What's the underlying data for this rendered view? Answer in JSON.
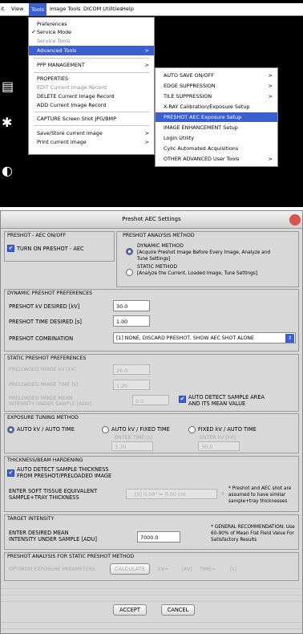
{
  "menubar": {
    "items": [
      "it",
      "View",
      "Tools",
      "Image Tools",
      "DICOM Utilities",
      "Help"
    ]
  },
  "tools_menu": {
    "items": [
      "Preferences",
      "Service Mode",
      "Service Tools",
      "Advanced Tools",
      "PPP MANAGEMENT",
      "PROPERTIES",
      "EDIT   Current Image Record",
      "DELETE  Current Image Record",
      "ADD    Current Image Record",
      "CAPTURE Screen Shot JPG/BMP",
      "Save/Store current image",
      "Print current image"
    ]
  },
  "advanced_menu": {
    "items": [
      "AUTO SAVE ON/OFF",
      "EDGE SUPPRESSION",
      "TILE SUPPRESSION",
      "X-RAY Calibration/Exposure Setup",
      "PRESHOT AEC Exposure Setup",
      "IMAGE ENHANCEMENT Setup",
      "Login Utility",
      "Cylic Automated Acquisitions",
      "OTHER ADVANCED User Tools"
    ]
  },
  "arrow": ">",
  "check": "✔",
  "dialog": {
    "title": "Preshot AEC Settings",
    "onoff": {
      "group": "PRESHOT - AEC ON/OFF",
      "label": "TURN ON PRESHOT - AEC"
    },
    "method": {
      "group": "PRESHOT ANALYSIS METHOD",
      "dynamic": "DYNAMIC METHOD",
      "dynamic_desc1": "[Acquire Preshot Image Before Every Image, Analyze and",
      "dynamic_desc2": "Tune Settings]",
      "static": "STATIC METHOD",
      "static_desc": "[Analyze the Current, Loaded Image, Tune Settings]"
    },
    "dynamic_prefs": {
      "group": "DYNAMIC PRESHOT PREFERENCES",
      "kv_label": "PRESHOT kV DESIRED  [kV]",
      "kv_value": "30.0",
      "time_label": "PRESHOT TIME DESIRED  [s]",
      "time_value": "1.00",
      "combo_label": "PRESHOT COMBINATION",
      "combo_value": "[1] NONE, DISCARD PRESHOT, SHOW AEC SHOT ALONE"
    },
    "static_prefs": {
      "group": "STATIC PRESHOT PREFERENCES",
      "kv_label": "PRELOADED IMAGE kV  [kV]",
      "kv_value": "26.0",
      "time_label": "PRELOADED IMAGE TIME  [s]",
      "time_value": "1.20",
      "mean_label1": "PRELOADED IMAGE MEAN",
      "mean_label2": "INTENSITY UNDER SAMPLE  [ADU]",
      "mean_value": "0.0",
      "auto_label1": "AUTO DETECT SAMPLE AREA",
      "auto_label2": "AND ITS MEAN VALUE"
    },
    "tuning": {
      "group": "EXPOSURE TUNING METHOD",
      "opt1": "AUTO kV / AUTO TIME",
      "opt2": "AUTO kV / FIXED TIME",
      "opt3": "FIXED kV / AUTO TIME",
      "enter_time": "ENTER TIME [s]",
      "enter_kv": "ENTER kV  [kV]",
      "time_value": "3.70",
      "kv_value": "30.0"
    },
    "thickness": {
      "group": "THICKNESS/BEAM HARDENING",
      "auto1": "AUTO DETECT SAMPLE THICKNESS",
      "auto2": "FROM PRESHOT/PRELOADED IMAGE",
      "enter1": "ENTER SOFT TISSUE EQUIVALENT",
      "enter2": "SAMPLE+TRAY THICKNESS",
      "combo_value": "[0]  0.00\" = 0.00 cm",
      "note1": "* Preshot and AEC shot are",
      "note2": "assumed to have similar",
      "note3": "sample+tray thicknesses"
    },
    "target": {
      "group": "TARGET INTENSITY",
      "label1": "ENTER DESIRED MEAN",
      "label2": "INTENSITY UNDER SAMPLE  [ADU]",
      "value": "7000.0",
      "rec1": "* GENERAL RECOMMENDATION: Use",
      "rec2": "60-90% of Mean Flat Field Value For",
      "rec3": "Satisfactory Results"
    },
    "analysis": {
      "group": "PRESHOT ANALYSIS FOR STATIC PRESHOT METHOD",
      "optimum": "OPTIMUM EXPOSURE PARAMETERS",
      "calculate": "CALCULATE",
      "kv": "kV=",
      "kv_unit": "[kV]",
      "time": "TIME=",
      "time_unit": "[s]"
    },
    "accept": "ACCEPT",
    "cancel": "CANCEL"
  },
  "colors": {
    "accent": "#3b5fcf",
    "dialog_bg": "#d8d8d8",
    "disabled": "#a8a8a8"
  }
}
